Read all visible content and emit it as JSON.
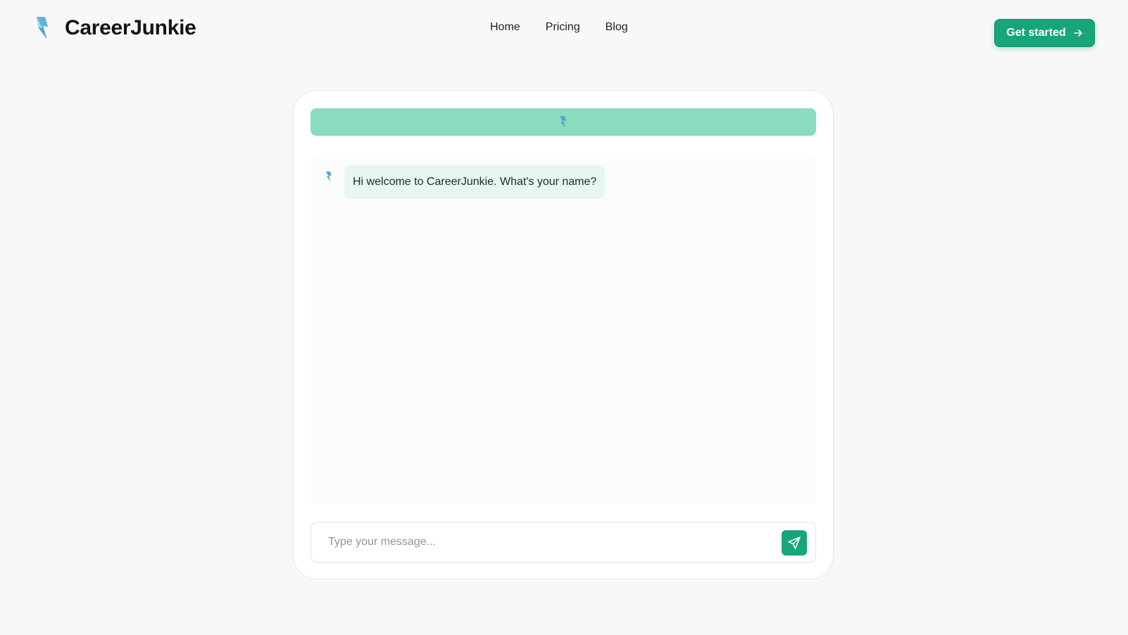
{
  "brand": {
    "name": "CareerJunkie",
    "logo_icon": "lightning-bolt-icon"
  },
  "nav": {
    "items": [
      {
        "label": "Home"
      },
      {
        "label": "Pricing"
      },
      {
        "label": "Blog"
      }
    ]
  },
  "cta": {
    "label": "Get started",
    "icon": "arrow-right-icon"
  },
  "chat": {
    "header_icon": "lightning-bolt-icon",
    "messages": [
      {
        "sender": "bot",
        "avatar_icon": "lightning-bolt-icon",
        "text": "Hi welcome to CareerJunkie. What's your name?"
      }
    ],
    "composer": {
      "placeholder": "Type your message...",
      "value": "",
      "send_icon": "send-icon"
    }
  },
  "colors": {
    "accent": "#17a67b",
    "header_bar": "#89dcbe",
    "bot_bubble": "#e8f6f0",
    "logo_blue": "#4da9cf",
    "background": "#f8f8f8"
  }
}
